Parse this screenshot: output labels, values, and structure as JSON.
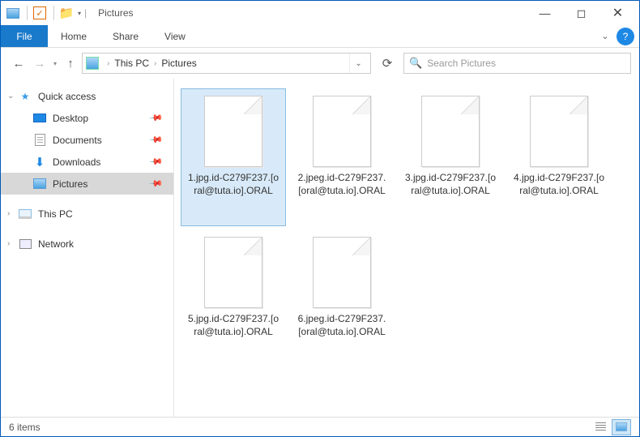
{
  "window": {
    "title": "Pictures"
  },
  "ribbon": {
    "file": "File",
    "tabs": [
      "Home",
      "Share",
      "View"
    ]
  },
  "breadcrumb": {
    "items": [
      "This PC",
      "Pictures"
    ]
  },
  "search": {
    "placeholder": "Search Pictures"
  },
  "sidebar": {
    "quick_access": {
      "label": "Quick access"
    },
    "items": [
      {
        "label": "Desktop",
        "pinned": true
      },
      {
        "label": "Documents",
        "pinned": true
      },
      {
        "label": "Downloads",
        "pinned": true
      },
      {
        "label": "Pictures",
        "pinned": true,
        "active": true
      }
    ],
    "this_pc": {
      "label": "This PC"
    },
    "network": {
      "label": "Network"
    }
  },
  "files": [
    {
      "name": "1.jpg.id-C279F237.[oral@tuta.io].ORAL",
      "selected": true
    },
    {
      "name": "2.jpeg.id-C279F237.[oral@tuta.io].ORAL"
    },
    {
      "name": "3.jpg.id-C279F237.[oral@tuta.io].ORAL"
    },
    {
      "name": "4.jpg.id-C279F237.[oral@tuta.io].ORAL"
    },
    {
      "name": "5.jpg.id-C279F237.[oral@tuta.io].ORAL"
    },
    {
      "name": "6.jpeg.id-C279F237.[oral@tuta.io].ORAL"
    }
  ],
  "status": {
    "count": "6 items"
  }
}
